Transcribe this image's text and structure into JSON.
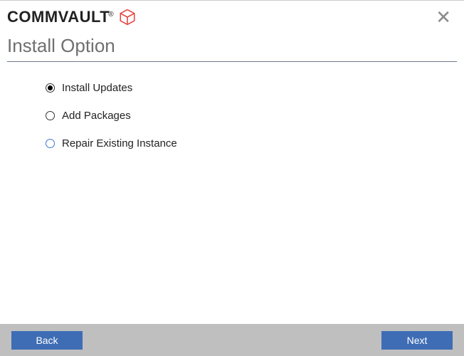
{
  "brand": {
    "name": "COMMVAULT",
    "logo_color": "#e8433f"
  },
  "close_symbol": "✕",
  "page_title": "Install Option",
  "options": [
    {
      "label": "Install Updates",
      "selected": true,
      "hover": false
    },
    {
      "label": "Add Packages",
      "selected": false,
      "hover": false
    },
    {
      "label": "Repair Existing Instance",
      "selected": false,
      "hover": true
    }
  ],
  "footer": {
    "back_label": "Back",
    "next_label": "Next"
  },
  "colors": {
    "button_bg": "#3e6db5",
    "footer_bg": "#bfbfbf"
  }
}
